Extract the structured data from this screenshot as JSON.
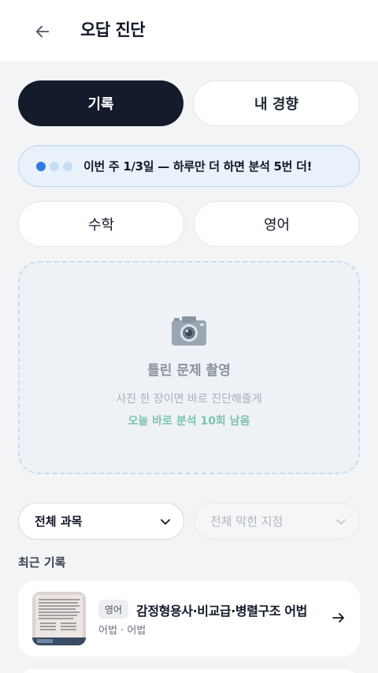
{
  "header": {
    "title": "오답 진단",
    "back_icon": "arrow-left-icon"
  },
  "tabs": [
    {
      "label": "기록",
      "active": true
    },
    {
      "label": "내 경향",
      "active": false
    }
  ],
  "streak": {
    "text": "이번 주 1/3일 — 하루만 더 하면 분석 5번 더!",
    "progress_days": 1,
    "target_days": 3
  },
  "subjects": [
    {
      "label": "수학"
    },
    {
      "label": "영어"
    }
  ],
  "upload": {
    "icon": "camera-icon",
    "title": "틀린 문제 촬영",
    "subtitle": "사진 한 장이면 바로 진단해줄게",
    "remaining": "오늘 바로 분석 10회 남음"
  },
  "filters": {
    "subject": {
      "value": "전체 과목"
    },
    "stuck_point": {
      "placeholder": "전체 막힌 지점"
    }
  },
  "recent": {
    "label": "최근 기록",
    "items": [
      {
        "badge": "영어",
        "title": "감정형용사·비교급·병렬구조 어법",
        "subtitle": "어법 · 어법"
      }
    ]
  },
  "colors": {
    "primary": "#141c2b",
    "accent": "#2f7ae5",
    "remaining": "#7cc2b1",
    "background": "#f3f4f6"
  }
}
